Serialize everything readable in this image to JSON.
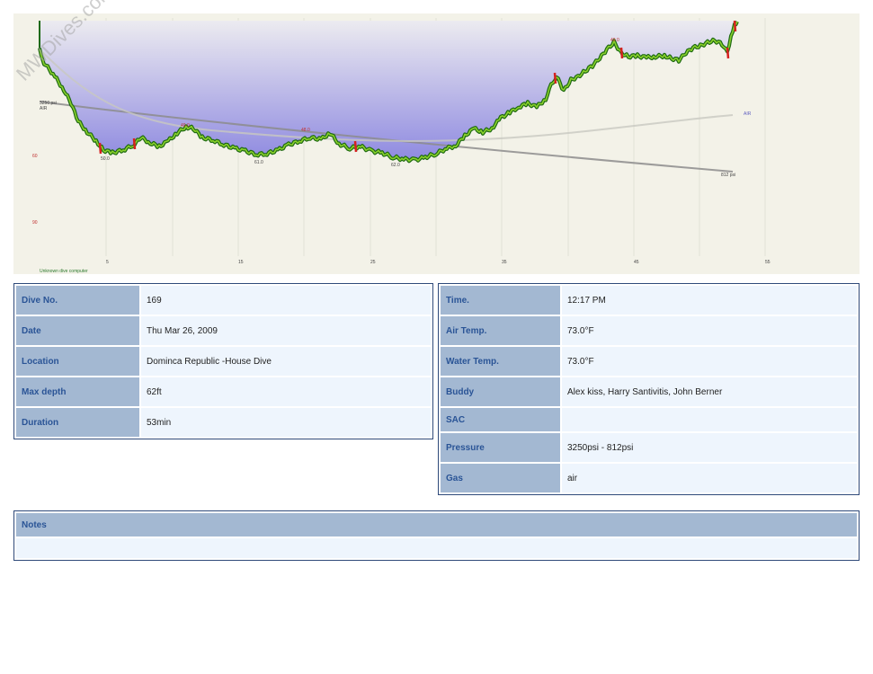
{
  "profile": {
    "watermark": "MWDives.com",
    "computer_label": "Unknown dive computer",
    "x_ticks": [
      "5",
      "15",
      "25",
      "35",
      "45",
      "55"
    ],
    "y_ticks": [
      "60",
      "90"
    ],
    "pressure_start": "3250 psi",
    "pressure_start_gas": "AIR",
    "pressure_end": "812 psi",
    "gas_end_label": "AIR",
    "depth_labels": [
      "50.0",
      "61.0",
      "62.0",
      "49.0",
      "48.0",
      "49.0"
    ],
    "colors": {
      "background": "#f3f2e8",
      "area_top": "#ecebf0",
      "area_bottom": "#8e89e0",
      "profile_line": "#1e6a12",
      "profile_highlight": "#8ad02c",
      "ascent_warning": "#d62020",
      "pressure_line": "#8c8c8c"
    }
  },
  "details": {
    "left": [
      {
        "label": "Dive No.",
        "value": "169"
      },
      {
        "label": "Date",
        "value": "Thu Mar 26, 2009"
      },
      {
        "label": "Location",
        "value": "Dominca Republic -House Dive"
      },
      {
        "label": "Max depth",
        "value": "62ft"
      },
      {
        "label": "Duration",
        "value": "53min"
      }
    ],
    "right": [
      {
        "label": "Time.",
        "value": "12:17 PM"
      },
      {
        "label": "Air Temp.",
        "value": "73.0°F"
      },
      {
        "label": "Water Temp.",
        "value": "73.0°F"
      },
      {
        "label": "Buddy",
        "value": "Alex kiss, Harry Santivitis, John Berner"
      },
      {
        "label": "SAC",
        "value": ""
      },
      {
        "label": "Pressure",
        "value": "3250psi - 812psi"
      },
      {
        "label": "Gas",
        "value": "air"
      }
    ],
    "notes_label": "Notes",
    "notes_value": ""
  }
}
